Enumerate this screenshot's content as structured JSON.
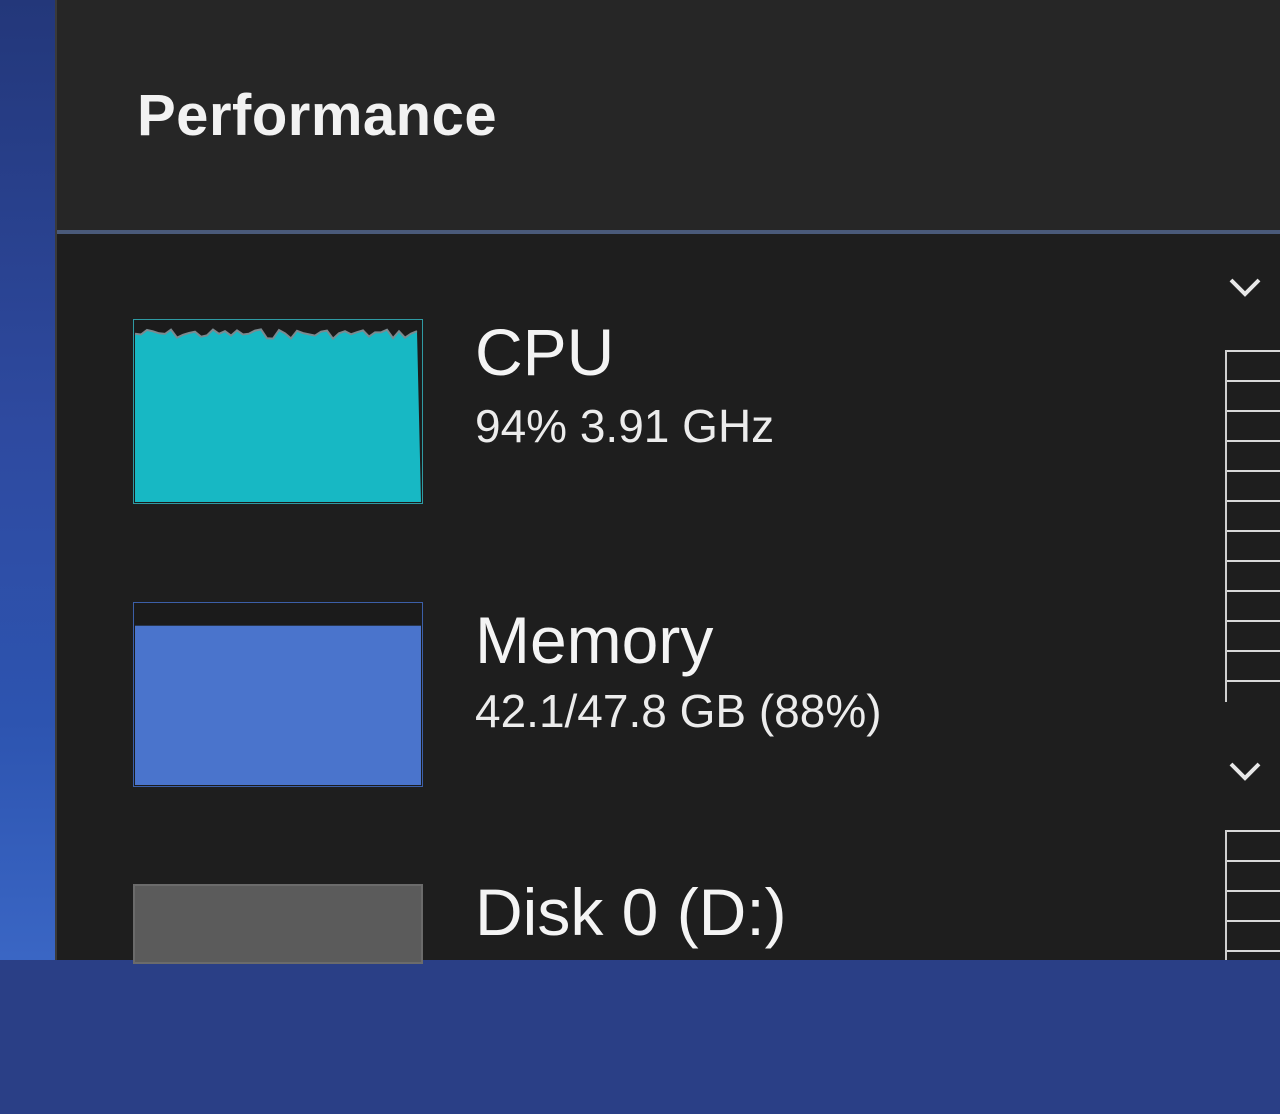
{
  "header": {
    "title": "Performance"
  },
  "items": [
    {
      "key": "cpu",
      "title": "CPU",
      "subtitle": "94%  3.91 GHz",
      "thumbnail_color": "#17b8c4",
      "usage_percent": 94
    },
    {
      "key": "memory",
      "title": "Memory",
      "subtitle": "42.1/47.8 GB (88%)",
      "thumbnail_color": "#4a74cc",
      "usage_percent": 88
    },
    {
      "key": "disk0",
      "title": "Disk 0 (D:)",
      "subtitle": "",
      "thumbnail_color": "#5b5b5b"
    }
  ],
  "icons": {
    "expand": "chevron-down-icon"
  },
  "colors": {
    "window_bg": "#202020",
    "header_bg": "#262626",
    "cpu_accent": "#17b8c4",
    "memory_accent": "#4a74cc"
  }
}
